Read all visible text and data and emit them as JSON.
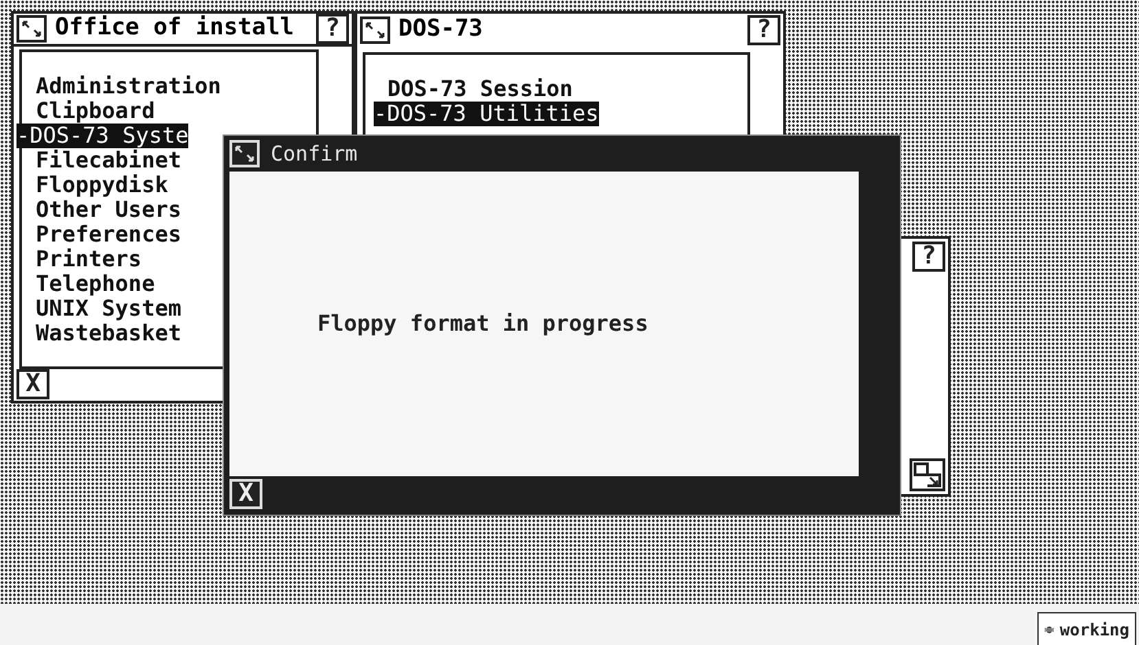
{
  "windows": [
    {
      "title": "Office of install",
      "help": "?",
      "close": "X",
      "items": [
        {
          "label": "Administration",
          "selected": false
        },
        {
          "label": "Clipboard",
          "selected": false
        },
        {
          "label": "-DOS-73 Syste",
          "selected": true
        },
        {
          "label": "Filecabinet",
          "selected": false
        },
        {
          "label": "Floppydisk",
          "selected": false
        },
        {
          "label": "Other Users",
          "selected": false
        },
        {
          "label": "Preferences",
          "selected": false
        },
        {
          "label": "Printers",
          "selected": false
        },
        {
          "label": "Telephone",
          "selected": false
        },
        {
          "label": "UNIX System",
          "selected": false
        },
        {
          "label": "Wastebasket",
          "selected": false
        }
      ]
    },
    {
      "title": "DOS-73",
      "help": "?",
      "items": [
        {
          "label": "DOS-73 Session",
          "selected": false
        },
        {
          "label": "-DOS-73 Utilities",
          "selected": true
        }
      ]
    }
  ],
  "back_window": {
    "help": "?"
  },
  "dialog": {
    "title": "Confirm",
    "message": "Floppy format in progress",
    "close": "X"
  },
  "status": {
    "label": "working"
  }
}
